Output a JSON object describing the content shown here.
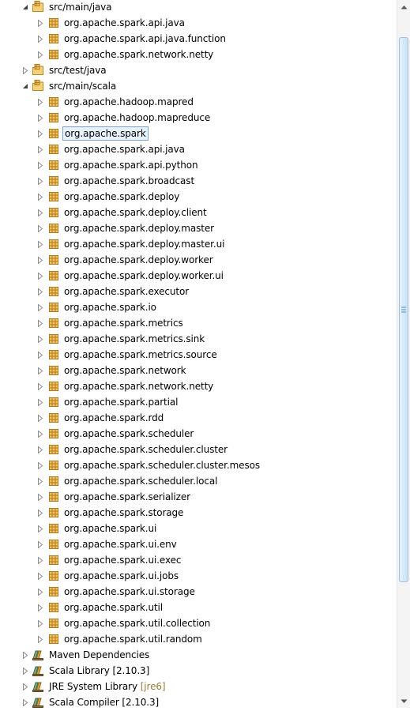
{
  "tree": [
    {
      "label": "src/main/java",
      "kind": "source-folder",
      "state": "expanded",
      "level": 0
    },
    {
      "label": "org.apache.spark.api.java",
      "kind": "package",
      "state": "collapsed",
      "level": 1
    },
    {
      "label": "org.apache.spark.api.java.function",
      "kind": "package",
      "state": "collapsed",
      "level": 1
    },
    {
      "label": "org.apache.spark.network.netty",
      "kind": "package",
      "state": "collapsed",
      "level": 1
    },
    {
      "label": "src/test/java",
      "kind": "source-folder",
      "state": "collapsed",
      "level": 0
    },
    {
      "label": "src/main/scala",
      "kind": "source-folder",
      "state": "expanded",
      "level": 0
    },
    {
      "label": "org.apache.hadoop.mapred",
      "kind": "package",
      "state": "collapsed",
      "level": 1
    },
    {
      "label": "org.apache.hadoop.mapreduce",
      "kind": "package",
      "state": "collapsed",
      "level": 1
    },
    {
      "label": "org.apache.spark",
      "kind": "package",
      "state": "collapsed",
      "level": 1,
      "selected": true
    },
    {
      "label": "org.apache.spark.api.java",
      "kind": "package",
      "state": "collapsed",
      "level": 1
    },
    {
      "label": "org.apache.spark.api.python",
      "kind": "package",
      "state": "collapsed",
      "level": 1
    },
    {
      "label": "org.apache.spark.broadcast",
      "kind": "package",
      "state": "collapsed",
      "level": 1
    },
    {
      "label": "org.apache.spark.deploy",
      "kind": "package",
      "state": "collapsed",
      "level": 1
    },
    {
      "label": "org.apache.spark.deploy.client",
      "kind": "package",
      "state": "collapsed",
      "level": 1
    },
    {
      "label": "org.apache.spark.deploy.master",
      "kind": "package",
      "state": "collapsed",
      "level": 1
    },
    {
      "label": "org.apache.spark.deploy.master.ui",
      "kind": "package",
      "state": "collapsed",
      "level": 1
    },
    {
      "label": "org.apache.spark.deploy.worker",
      "kind": "package",
      "state": "collapsed",
      "level": 1
    },
    {
      "label": "org.apache.spark.deploy.worker.ui",
      "kind": "package",
      "state": "collapsed",
      "level": 1
    },
    {
      "label": "org.apache.spark.executor",
      "kind": "package",
      "state": "collapsed",
      "level": 1
    },
    {
      "label": "org.apache.spark.io",
      "kind": "package",
      "state": "collapsed",
      "level": 1
    },
    {
      "label": "org.apache.spark.metrics",
      "kind": "package",
      "state": "collapsed",
      "level": 1
    },
    {
      "label": "org.apache.spark.metrics.sink",
      "kind": "package",
      "state": "collapsed",
      "level": 1
    },
    {
      "label": "org.apache.spark.metrics.source",
      "kind": "package",
      "state": "collapsed",
      "level": 1
    },
    {
      "label": "org.apache.spark.network",
      "kind": "package",
      "state": "collapsed",
      "level": 1
    },
    {
      "label": "org.apache.spark.network.netty",
      "kind": "package",
      "state": "collapsed",
      "level": 1
    },
    {
      "label": "org.apache.spark.partial",
      "kind": "package",
      "state": "collapsed",
      "level": 1
    },
    {
      "label": "org.apache.spark.rdd",
      "kind": "package",
      "state": "collapsed",
      "level": 1
    },
    {
      "label": "org.apache.spark.scheduler",
      "kind": "package",
      "state": "collapsed",
      "level": 1
    },
    {
      "label": "org.apache.spark.scheduler.cluster",
      "kind": "package",
      "state": "collapsed",
      "level": 1
    },
    {
      "label": "org.apache.spark.scheduler.cluster.mesos",
      "kind": "package",
      "state": "collapsed",
      "level": 1
    },
    {
      "label": "org.apache.spark.scheduler.local",
      "kind": "package",
      "state": "collapsed",
      "level": 1
    },
    {
      "label": "org.apache.spark.serializer",
      "kind": "package",
      "state": "collapsed",
      "level": 1
    },
    {
      "label": "org.apache.spark.storage",
      "kind": "package",
      "state": "collapsed",
      "level": 1
    },
    {
      "label": "org.apache.spark.ui",
      "kind": "package",
      "state": "collapsed",
      "level": 1
    },
    {
      "label": "org.apache.spark.ui.env",
      "kind": "package",
      "state": "collapsed",
      "level": 1
    },
    {
      "label": "org.apache.spark.ui.exec",
      "kind": "package",
      "state": "collapsed",
      "level": 1
    },
    {
      "label": "org.apache.spark.ui.jobs",
      "kind": "package",
      "state": "collapsed",
      "level": 1
    },
    {
      "label": "org.apache.spark.ui.storage",
      "kind": "package",
      "state": "collapsed",
      "level": 1
    },
    {
      "label": "org.apache.spark.util",
      "kind": "package",
      "state": "collapsed",
      "level": 1
    },
    {
      "label": "org.apache.spark.util.collection",
      "kind": "package",
      "state": "collapsed",
      "level": 1
    },
    {
      "label": "org.apache.spark.util.random",
      "kind": "package",
      "state": "collapsed",
      "level": 1
    },
    {
      "label": "Maven Dependencies",
      "kind": "library",
      "state": "collapsed",
      "level": 0
    },
    {
      "label": "Scala Library [2.10.3]",
      "kind": "library",
      "state": "collapsed",
      "level": 0
    },
    {
      "label": "JRE System Library",
      "decoration": "[jre6]",
      "kind": "library",
      "state": "collapsed",
      "level": 0
    },
    {
      "label": "Scala Compiler [2.10.3]",
      "kind": "library",
      "state": "collapsed",
      "level": 0
    }
  ],
  "icons": {
    "source-folder": "source-folder-icon",
    "package": "package-icon",
    "library": "library-icon"
  },
  "colors": {
    "package_fill": "#f3c262",
    "package_stroke": "#b07a1c",
    "folder_fill": "#f5d27a",
    "selection_border": "#7da2ce",
    "selection_bg": "#e8f2fd",
    "scroll_thumb": "#c9e2f7"
  },
  "scrollbar": {
    "position": 0.5
  }
}
